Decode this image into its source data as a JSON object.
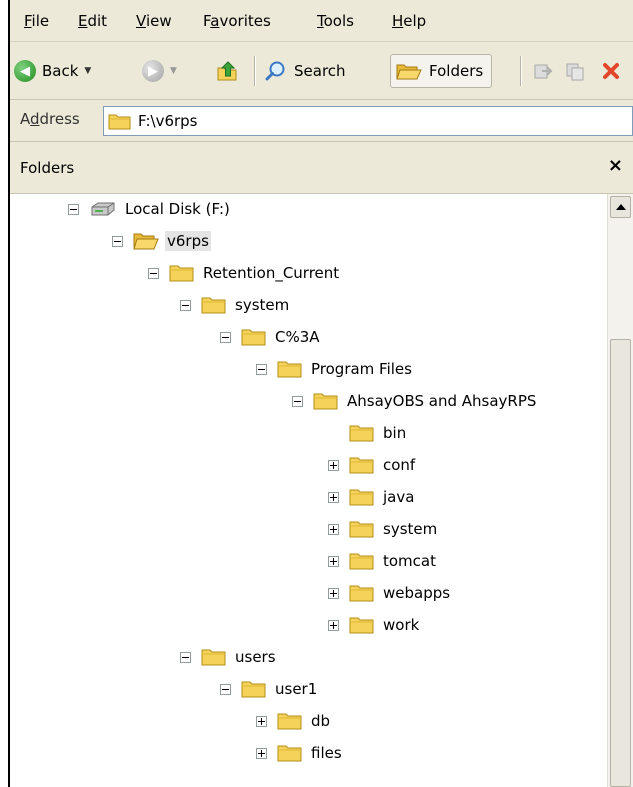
{
  "menu": [
    {
      "acc": "F",
      "rest": "ile"
    },
    {
      "acc": "E",
      "rest": "dit"
    },
    {
      "acc": "V",
      "rest": "iew"
    },
    {
      "pre": "F",
      "acc": "a",
      "rest": "vorites"
    },
    {
      "acc": "T",
      "rest": "ools"
    },
    {
      "acc": "H",
      "rest": "elp"
    }
  ],
  "toolbar": {
    "back_label": "Back",
    "search_label": "Search",
    "folders_label": "Folders"
  },
  "address": {
    "label_pre": "A",
    "label_acc": "d",
    "label_rest": "dress",
    "value": "F:\\v6rps"
  },
  "pane": {
    "title": "Folders",
    "close": "×"
  },
  "tree": [
    {
      "label": "Local Disk  (F:)",
      "expander": "minus",
      "icon": "disk-icon"
    },
    {
      "label": "v6rps",
      "expander": "minus",
      "icon": "open-folder-icon",
      "selected": true
    },
    {
      "label": "Retention_Current",
      "expander": "minus",
      "icon": "folder-icon"
    },
    {
      "label": "system",
      "expander": "minus",
      "icon": "folder-icon"
    },
    {
      "label": "C%3A",
      "expander": "minus",
      "icon": "folder-icon"
    },
    {
      "label": "Program Files",
      "expander": "minus",
      "icon": "folder-icon"
    },
    {
      "label": "AhsayOBS and AhsayRPS",
      "expander": "minus",
      "icon": "folder-icon"
    },
    {
      "label": "bin",
      "expander": "none",
      "icon": "folder-icon"
    },
    {
      "label": "conf",
      "expander": "plus",
      "icon": "folder-icon"
    },
    {
      "label": "java",
      "expander": "plus",
      "icon": "folder-icon"
    },
    {
      "label": "system",
      "expander": "plus",
      "icon": "folder-icon"
    },
    {
      "label": "tomcat",
      "expander": "plus",
      "icon": "folder-icon"
    },
    {
      "label": "webapps",
      "expander": "plus",
      "icon": "folder-icon"
    },
    {
      "label": "work",
      "expander": "plus",
      "icon": "folder-icon"
    },
    {
      "label": "users",
      "expander": "minus",
      "icon": "folder-icon"
    },
    {
      "label": "user1",
      "expander": "minus",
      "icon": "folder-icon"
    },
    {
      "label": "db",
      "expander": "plus",
      "icon": "folder-icon"
    },
    {
      "label": "files",
      "expander": "plus",
      "icon": "folder-icon"
    }
  ]
}
